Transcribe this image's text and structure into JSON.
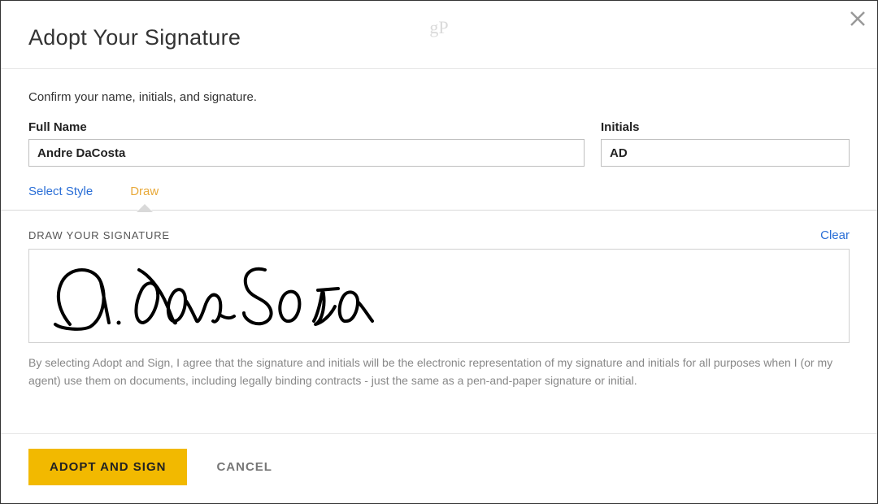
{
  "watermark": "gP",
  "header": {
    "title": "Adopt Your Signature"
  },
  "instruction": "Confirm your name, initials, and signature.",
  "fields": {
    "full_name": {
      "label": "Full Name",
      "value": "Andre DaCosta"
    },
    "initials": {
      "label": "Initials",
      "value": "AD"
    }
  },
  "tabs": {
    "select_style": "Select Style",
    "draw": "Draw",
    "active": "draw"
  },
  "draw_section": {
    "label": "DRAW YOUR SIGNATURE",
    "clear": "Clear"
  },
  "legal": "By selecting Adopt and Sign, I agree that the signature and initials will be the electronic representation of my signature and initials for all purposes when I (or my agent) use them on documents, including legally binding contracts - just the same as a pen-and-paper signature or initial.",
  "footer": {
    "primary": "ADOPT AND SIGN",
    "secondary": "CANCEL"
  }
}
